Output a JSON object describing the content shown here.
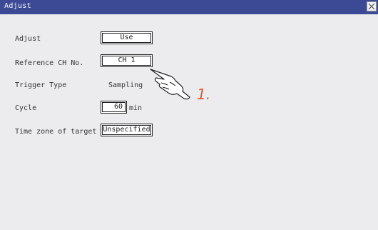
{
  "window": {
    "title": "Adjust"
  },
  "rows": [
    {
      "label": "Adjust",
      "value": "Use"
    },
    {
      "label": "Reference CH No.",
      "value": "CH 1"
    },
    {
      "label": "Trigger Type",
      "value": "Sampling"
    },
    {
      "label": "Cycle",
      "value": "60",
      "unit": "min"
    },
    {
      "label": "Time zone of target",
      "value": "Unspecified"
    }
  ],
  "annotation": {
    "step": "1."
  },
  "colors": {
    "titlebar": "#3c4a96",
    "panel": "#ececee",
    "step": "#e0582e"
  },
  "icons": {
    "close": "close-icon",
    "pointer": "pointing-hand-icon"
  }
}
